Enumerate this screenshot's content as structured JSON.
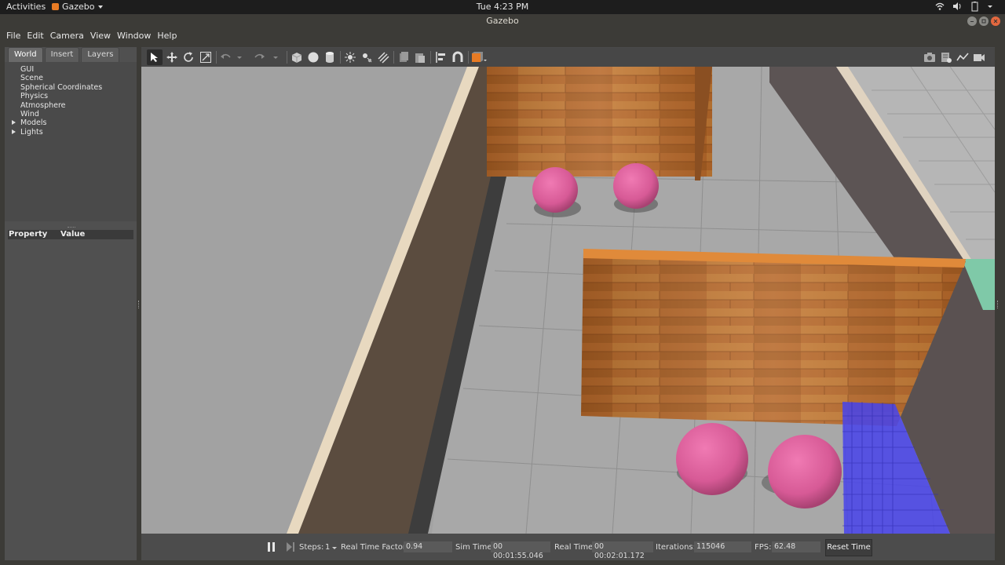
{
  "topbar": {
    "activities": "Activities",
    "app_name": "Gazebo",
    "clock": "Tue  4:23 PM"
  },
  "window": {
    "title": "Gazebo"
  },
  "menubar": [
    "File",
    "Edit",
    "Camera",
    "View",
    "Window",
    "Help"
  ],
  "left_panel": {
    "tabs": [
      "World",
      "Insert",
      "Layers"
    ],
    "active_tab": "World",
    "tree": [
      {
        "label": "GUI",
        "expandable": false
      },
      {
        "label": "Scene",
        "expandable": false
      },
      {
        "label": "Spherical Coordinates",
        "expandable": false
      },
      {
        "label": "Physics",
        "expandable": false
      },
      {
        "label": "Atmosphere",
        "expandable": false
      },
      {
        "label": "Wind",
        "expandable": false
      },
      {
        "label": "Models",
        "expandable": true
      },
      {
        "label": "Lights",
        "expandable": true
      }
    ],
    "property_header": {
      "property": "Property",
      "value": "Value"
    }
  },
  "statusbar": {
    "steps_label": "Steps:",
    "steps_value": "1",
    "rtf_label": "Real Time Factor:",
    "rtf_value": "0.94",
    "sim_time_label": "Sim Time:",
    "sim_time_value": "00 00:01:55.046",
    "real_time_label": "Real Time:",
    "real_time_value": "00 00:02:01.172",
    "iterations_label": "Iterations:",
    "iterations_value": "115046",
    "fps_label": "FPS:",
    "fps_value": "62.48",
    "reset_label": "Reset Time"
  },
  "colors": {
    "accent_orange": "#e87b24",
    "sphere_pink": "#e0609a",
    "floor_gray": "#a9a9a9",
    "wood": "#b56a2a",
    "blue_region": "#4a46e8"
  }
}
